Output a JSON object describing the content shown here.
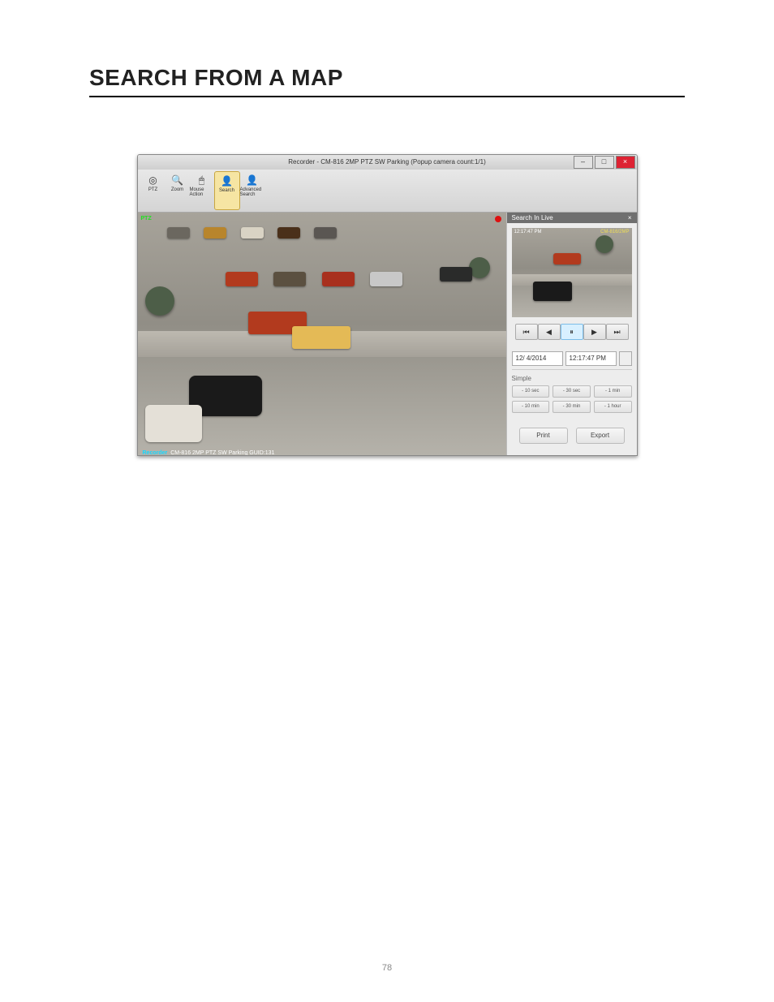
{
  "heading": "SEARCH FROM A MAP",
  "footer_page": "78",
  "window": {
    "title": "Recorder - CM-816 2MP PTZ SW Parking (Popup camera count:1/1)",
    "buttons": {
      "min": "–",
      "max": "□",
      "close": "×"
    },
    "toolbar": [
      {
        "label": "PTZ",
        "icon": "◎",
        "name": "ptz-button"
      },
      {
        "label": "Zoom",
        "icon": "🔍",
        "name": "zoom-button"
      },
      {
        "label": "Mouse Action",
        "icon": "🖱",
        "name": "mouse-action-button"
      },
      {
        "label": "Search",
        "icon": "👤",
        "name": "search-button",
        "active": true
      },
      {
        "label": "Advanced Search",
        "icon": "👤",
        "name": "advanced-search-button"
      }
    ],
    "live": {
      "ptz_badge": "PTZ",
      "recorder_tag": "Recorder",
      "camera_label": "CM-816 2MP PTZ SW Parking GUID:131"
    },
    "panel": {
      "header": "Search In Live",
      "thumb": {
        "timestamp": "12:17:47 PM",
        "camera": "CM-816/2MP"
      },
      "playback": [
        "⏮",
        "◀",
        "⏸",
        "▶",
        "⏭"
      ],
      "active_pb_index": 2,
      "date": "12/ 4/2014",
      "time": "12:17:47 PM",
      "section_label": "Simple",
      "jump_row1": [
        "- 10 sec",
        "- 30 sec",
        "- 1 min"
      ],
      "jump_row2": [
        "- 10 min",
        "- 30 min",
        "- 1 hour"
      ],
      "actions": {
        "print": "Print",
        "export": "Export"
      }
    }
  }
}
